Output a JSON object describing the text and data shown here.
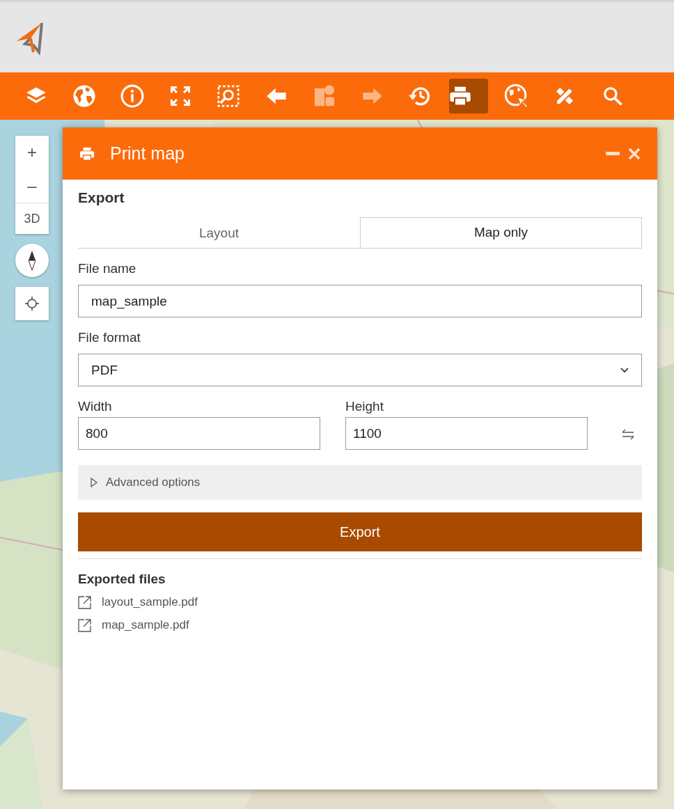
{
  "toolbar": {
    "tools": [
      {
        "selected": false,
        "disabled": false
      },
      {
        "selected": false,
        "disabled": false
      },
      {
        "selected": false,
        "disabled": false
      },
      {
        "selected": false,
        "disabled": false
      },
      {
        "selected": false,
        "disabled": false
      },
      {
        "selected": false,
        "disabled": false
      },
      {
        "selected": false,
        "disabled": true
      },
      {
        "selected": false,
        "disabled": true
      },
      {
        "selected": false,
        "disabled": false
      },
      {
        "selected": true,
        "disabled": false
      },
      {
        "selected": false,
        "disabled": false
      },
      {
        "selected": false,
        "disabled": false
      },
      {
        "selected": false,
        "disabled": false
      }
    ]
  },
  "map_controls": {
    "zoom_in": "+",
    "zoom_out": "–",
    "view_3d": "3D"
  },
  "panel": {
    "title": "Print map",
    "section_title": "Export",
    "tabs": [
      {
        "label": "Layout",
        "selected": false
      },
      {
        "label": "Map only",
        "selected": true
      }
    ],
    "file_name": {
      "label": "File name",
      "value": "map_sample"
    },
    "file_format": {
      "label": "File format",
      "value": "PDF"
    },
    "width": {
      "label": "Width",
      "value": "800"
    },
    "height": {
      "label": "Height",
      "value": "1100"
    },
    "advanced": {
      "label": "Advanced options",
      "expanded": false
    },
    "export_button": "Export",
    "exported_title": "Exported files",
    "exported_files": [
      "layout_sample.pdf",
      "map_sample.pdf"
    ]
  }
}
